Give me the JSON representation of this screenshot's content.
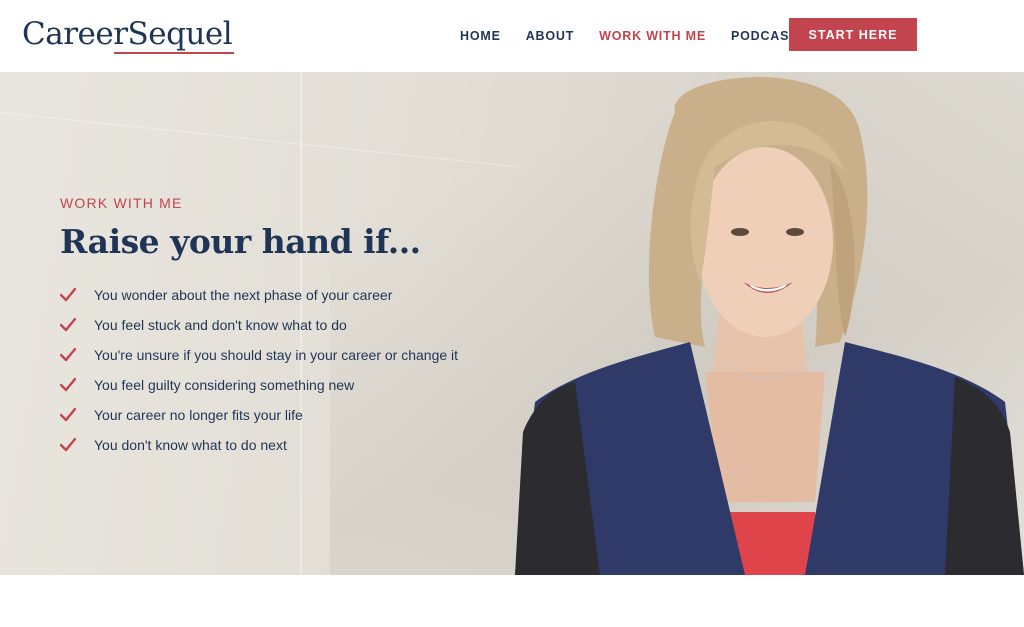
{
  "header": {
    "logo_text": "CareerSequel",
    "nav": [
      {
        "label": "HOME",
        "active": false
      },
      {
        "label": "ABOUT",
        "active": false
      },
      {
        "label": "WORK WITH ME",
        "active": true
      },
      {
        "label": "PODCAST",
        "active": false
      }
    ],
    "cta_label": "START HERE"
  },
  "hero": {
    "eyebrow": "WORK WITH ME",
    "headline": "Raise your hand if...",
    "checklist": [
      "You wonder about the next phase of your career",
      "You feel stuck and don't know what to do",
      "You're unsure if you should stay in your career or change it",
      "You feel guilty considering something new",
      "Your career no longer fits your life",
      "You don't know what to do next"
    ],
    "check_icon": "checkmark-icon",
    "portrait": "portrait-photo"
  },
  "colors": {
    "accent": "#c2444e",
    "navy": "#1f3556",
    "background": "#e4e1da"
  }
}
